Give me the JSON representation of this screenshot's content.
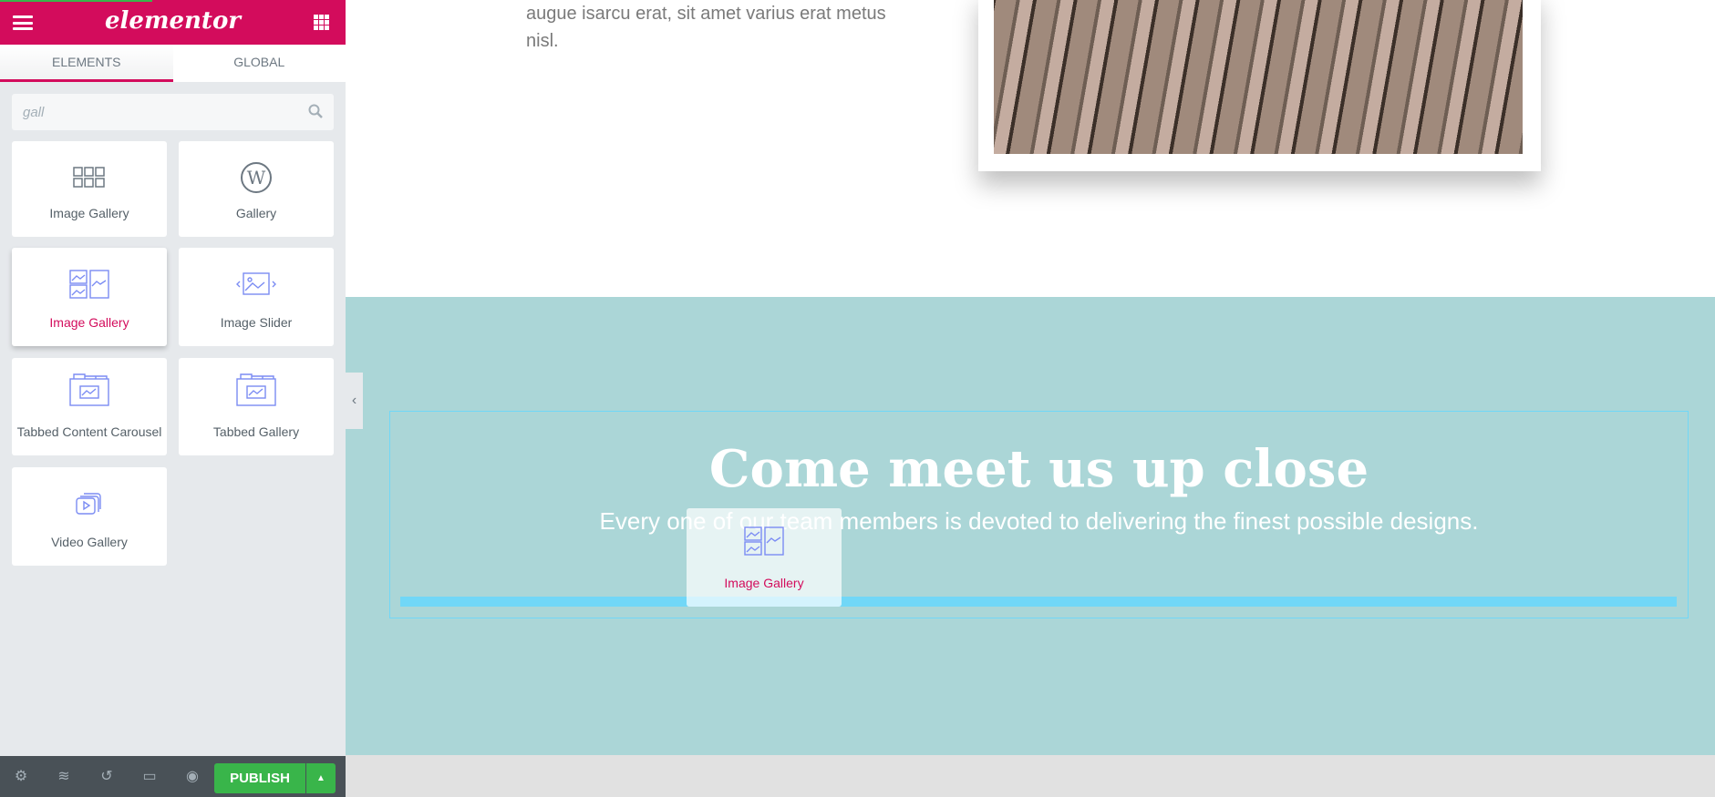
{
  "app": {
    "logo": "elementor"
  },
  "tabs": [
    {
      "label": "ELEMENTS",
      "active": true
    },
    {
      "label": "GLOBAL",
      "active": false
    }
  ],
  "search": {
    "value": "gall"
  },
  "widgets": [
    {
      "label": "Image Gallery",
      "icon": "grid-gallery-icon"
    },
    {
      "label": "Gallery",
      "icon": "wordpress-icon"
    },
    {
      "label": "Image Gallery",
      "icon": "image-gallery-icon",
      "highlighted": true
    },
    {
      "label": "Image Slider",
      "icon": "image-slider-icon"
    },
    {
      "label": "Tabbed Content Carousel",
      "icon": "tabbed-carousel-icon"
    },
    {
      "label": "Tabbed Gallery",
      "icon": "tabbed-gallery-icon"
    },
    {
      "label": "Video Gallery",
      "icon": "video-gallery-icon"
    }
  ],
  "footer": {
    "publish_label": "PUBLISH"
  },
  "page": {
    "paragraph_lines": [
      "augue isarcu erat, sit amet varius erat metus",
      "nisl."
    ],
    "heading": "Come meet us up close",
    "subheading": "Every one of our team members is devoted to delivering the finest possible designs."
  },
  "drag_ghost": {
    "label": "Image Gallery"
  },
  "colors": {
    "brand": "#d30c5c",
    "section_bg": "#abd6d7",
    "publish": "#39b54a",
    "drop_indicator": "#71d7f7"
  }
}
